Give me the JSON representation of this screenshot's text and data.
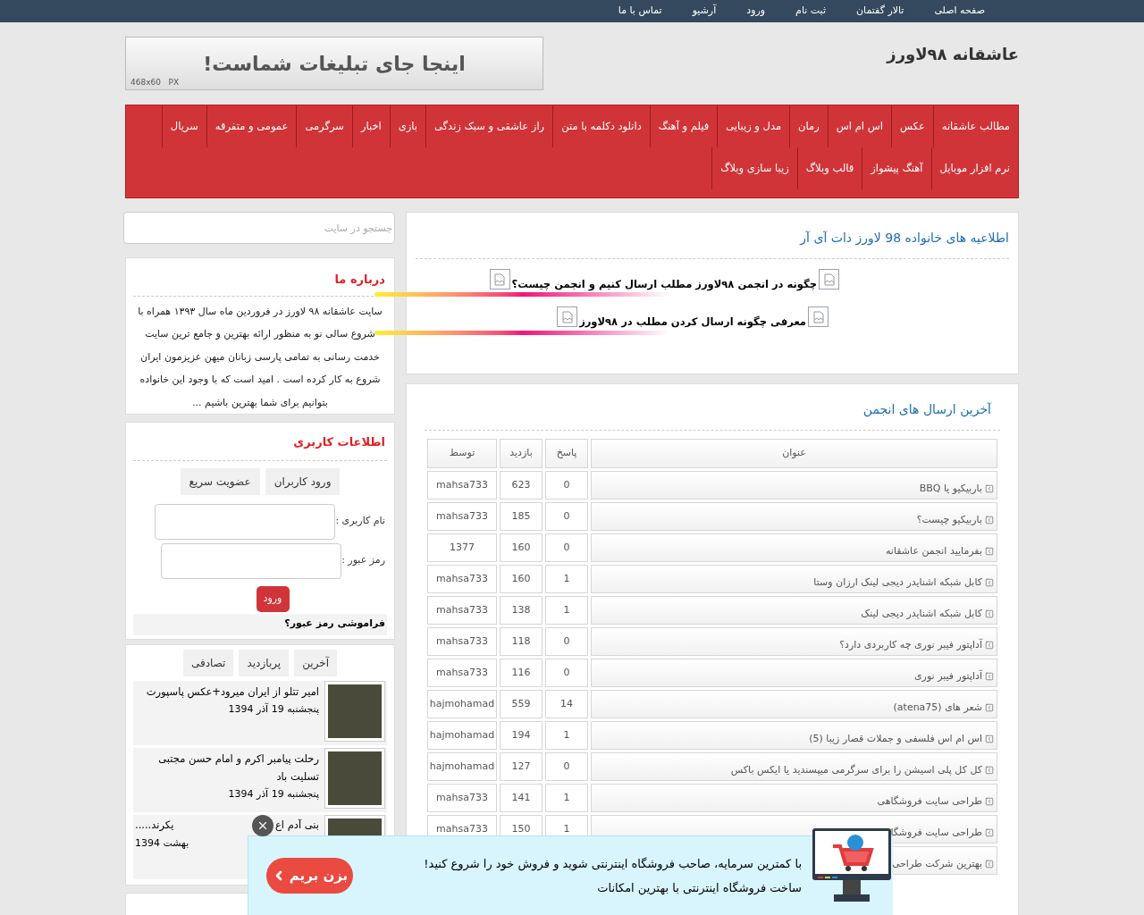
{
  "top_nav": {
    "items": [
      "صفحه اصلی",
      "تالار گفتمان",
      "ثبت نام",
      "ورود",
      "آرشیو",
      "تماس با ما"
    ]
  },
  "header": {
    "site_title": "عاشقانه ۹۸لاورز",
    "ad_banner": {
      "text": "اینجا جای تبلیغات شماست!",
      "size_label": "468x60   PX"
    }
  },
  "main_menu": {
    "items": [
      "مطالب عاشقانه",
      "عکس",
      "اس ام اس",
      "رمان",
      "مدل و زیبایی",
      "فیلم و آهنگ",
      "دانلود دکلمه با متن",
      "راز عاشقی و سبک زندگی",
      "بازی",
      "اخبار",
      "سرگرمی",
      "عمومی و متفرقه",
      "سریال",
      "نرم افزار موبایل",
      "آهنگ پیشواز",
      "قالب وبلاگ",
      "زیبا سازی وبلاگ"
    ]
  },
  "sidebar": {
    "search": {
      "placeholder": "جستجو در سایت"
    },
    "about": {
      "title": "درباره ما",
      "paragraph": "سایت عاشقانه ۹۸ لاورز در فروردین ماه سال ۱۳۹۳ همراه با شروع سالی نو به منظور ارائه بهترین و جامع ترین سایت خدمت رسانی به تمامی پارسی زبانان میهن عزیزمون ایران شروع به کار کرده است . امید است که با وجود این خانواده بتوانیم برای شما بهترین باشیم ..."
    },
    "user_info": {
      "title": "اطلاعات کاربری",
      "tabs": [
        "ورود کاربران",
        "عضویت سریع"
      ],
      "fields": [
        {
          "label": "نام کاربری :"
        },
        {
          "label": "رمز عبور :"
        }
      ],
      "login_button": "ورود",
      "forgot_link": "فراموشی رمز عبور؟"
    },
    "posts": {
      "tabs": [
        "آخرین",
        "پربازدید",
        "تصادفی"
      ],
      "items": [
        {
          "kind": "full",
          "title": "امیر تتلو از ایران میرود+عکس پاسپورت",
          "date": "پنجشنبه 19 آذر 1394"
        },
        {
          "kind": "full",
          "title": "رحلت پیامبر اکرم و امام حسن مجتبی تسلیت باد",
          "date": "پنجشنبه 19 آذر 1394"
        },
        {
          "kind": "partly_hidden",
          "title": "بنی آدم اع",
          "title_tail": "یکرند.....",
          "date": "بهشت 1394"
        }
      ]
    }
  },
  "announcements": {
    "title": "اطلاعیه های خانواده 98 لاورز دات آی آر",
    "items": [
      "چگونه در انجمن ۹۸لاورز مطلب ارسال کنیم و انجمن چیست؟",
      "معرفی چگونه ارسال کردن مطلب در ۹۸لاورز"
    ]
  },
  "forum": {
    "title": "آخرین ارسال های انجمن",
    "columns": [
      "عنوان",
      "پاسخ",
      "بازدید",
      "توسط"
    ],
    "rows": [
      {
        "title": "باربیکیو یا BBQ",
        "replies": "0",
        "views": "623",
        "author": "mahsa733"
      },
      {
        "title": "باربیکیو چیست؟",
        "replies": "0",
        "views": "185",
        "author": "mahsa733"
      },
      {
        "title": "بفرمایید انجمن عاشقانه",
        "replies": "0",
        "views": "160",
        "author": "1377"
      },
      {
        "title": "کابل شبکه اشنایدر دیجی لینک ارزان وستا",
        "replies": "1",
        "views": "160",
        "author": "mahsa733"
      },
      {
        "title": "کابل شبکه اشنایدر دیجی لینک",
        "replies": "1",
        "views": "138",
        "author": "mahsa733"
      },
      {
        "title": "آداپتور فیبر نوری چه کاربردی دارد؟",
        "replies": "0",
        "views": "118",
        "author": "mahsa733"
      },
      {
        "title": "آداپتور فیبر نوری",
        "replies": "0",
        "views": "116",
        "author": "mahsa733"
      },
      {
        "title": "شعر های (atena75)",
        "replies": "14",
        "views": "559",
        "author": "hajmohamad"
      },
      {
        "title": "اس ام اس فلسفی و جملات قصار زیبا (5)",
        "replies": "1",
        "views": "194",
        "author": "hajmohamad"
      },
      {
        "title": "کل کل پلی اسیشن را برای سرگرمی میپسندید یا ایکس باکس",
        "replies": "0",
        "views": "127",
        "author": "hajmohamad"
      },
      {
        "title": "طراحی سایت فروشگاهی",
        "replies": "1",
        "views": "141",
        "author": "mahsa733"
      },
      {
        "title": "طراحی سایت فروشگا",
        "replies": "1",
        "views": "150",
        "author": "mahsa733"
      },
      {
        "title": "بهترین شرکت طراحی"
      }
    ]
  },
  "popup": {
    "lines": [
      "با کمترین سرمایه، صاحب فروشگاه اینترنتی شوید و فروش خود را شروع کنید!",
      "ساخت فروشگاه اینترنتی با بهترین امکانات"
    ],
    "button": "بزن بریم"
  }
}
